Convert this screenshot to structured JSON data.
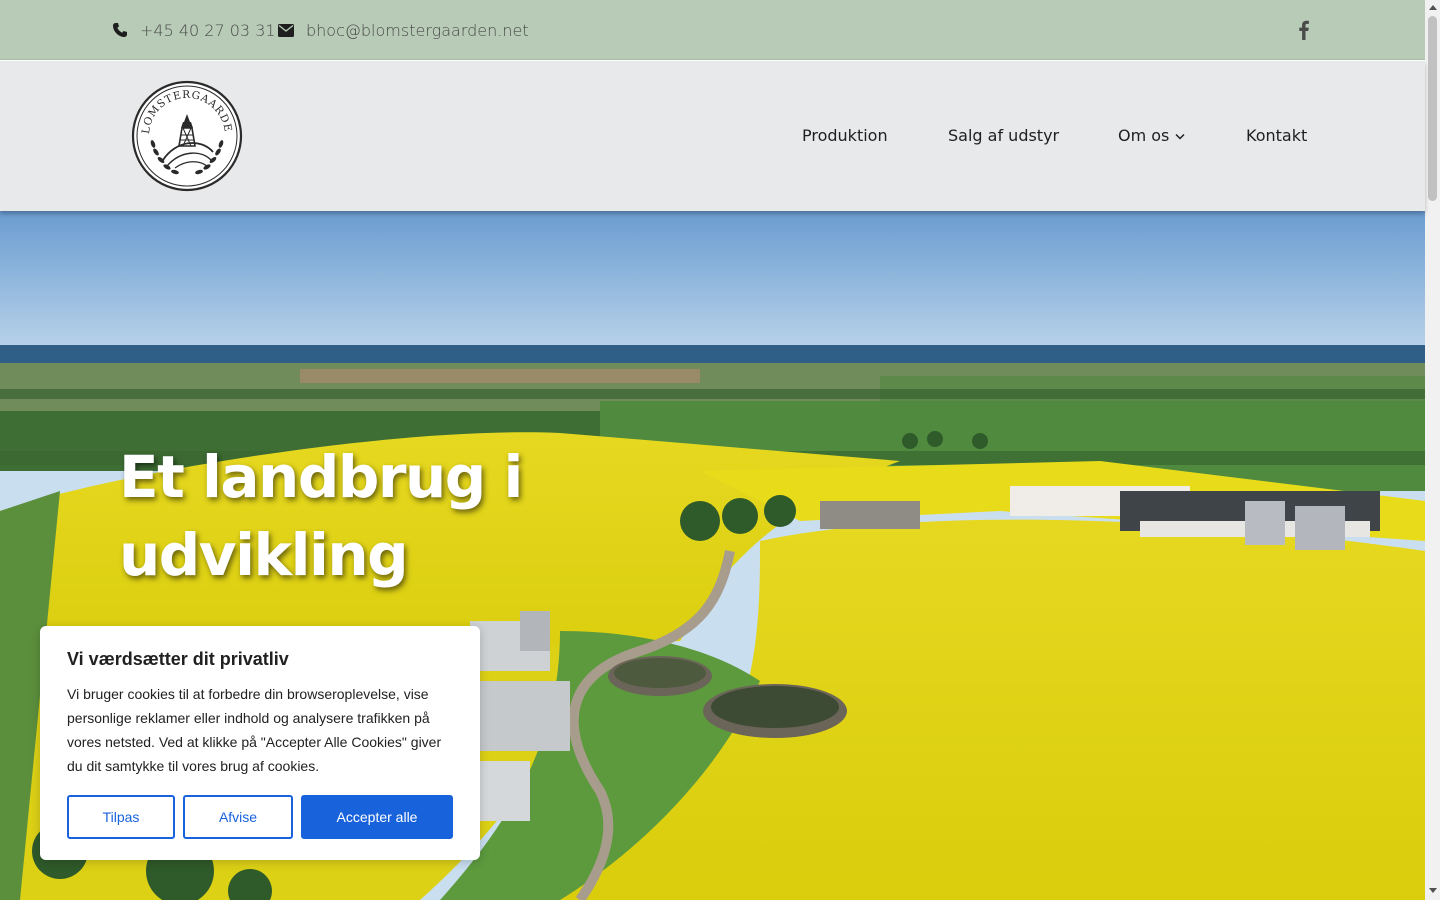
{
  "topbar": {
    "phone": "+45 40 27 03 31",
    "email": "bhoc@blomstergaarden.net",
    "social_icon": "facebook-icon"
  },
  "header": {
    "logo_text": "BLOMSTERGAARDEN",
    "nav": {
      "produktion": "Produktion",
      "salg": "Salg af udstyr",
      "om_os": "Om os",
      "kontakt": "Kontakt"
    }
  },
  "hero": {
    "title_line1": "Et landbrug i",
    "title_line2": "udvikling"
  },
  "cookie": {
    "title": "Vi værdsætter dit privatliv",
    "text": "Vi bruger cookies til at forbedre din browseroplevelse, vise personlige reklamer eller indhold og analysere trafikken på vores netsted. Ved at klikke på \"Accepter Alle Cookies\" giver du dit samtykke til vores brug af cookies.",
    "customize": "Tilpas",
    "reject": "Afvise",
    "accept": "Accepter alle"
  },
  "colors": {
    "topbar_bg": "#b7cbb7",
    "header_bg": "#e8e9ea",
    "accent_blue": "#1863dc",
    "rapeseed_yellow": "#e8dc1a"
  }
}
